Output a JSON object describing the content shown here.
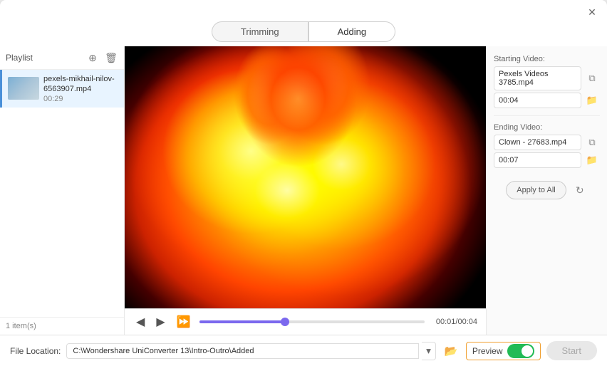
{
  "window": {
    "close_label": "✕"
  },
  "tabs": [
    {
      "id": "trimming",
      "label": "Trimming",
      "active": false
    },
    {
      "id": "adding",
      "label": "Adding",
      "active": true
    }
  ],
  "sidebar": {
    "title": "Playlist",
    "add_icon": "⊕",
    "delete_icon": "🗑",
    "items": [
      {
        "name": "pexels-mikhail-nilov-6563907.mp4",
        "duration": "00:29"
      }
    ],
    "footer": "1 item(s)"
  },
  "right_panel": {
    "starting_video": {
      "label": "Starting Video:",
      "filename": "Pexels Videos 3785.mp4",
      "time": "00:04",
      "copy_icon": "⧉",
      "folder_icon": "📁"
    },
    "ending_video": {
      "label": "Ending Video:",
      "filename": "Clown - 27683.mp4",
      "time": "00:07",
      "copy_icon": "⧉",
      "folder_icon": "📁"
    },
    "apply_btn": "Apply to All",
    "refresh_icon": "↻"
  },
  "controls": {
    "prev_icon": "◀",
    "play_icon": "▶",
    "next_icon": "⏩",
    "time_current": "00:01",
    "time_total": "00:04",
    "time_separator": "/"
  },
  "bottom_bar": {
    "file_label": "File Location:",
    "file_path": "C:\\Wondershare UniConverter 13\\Intro-Outro\\Added",
    "dropdown_icon": "▾",
    "folder_icon": "📂",
    "preview_label": "Preview",
    "start_label": "Start"
  }
}
